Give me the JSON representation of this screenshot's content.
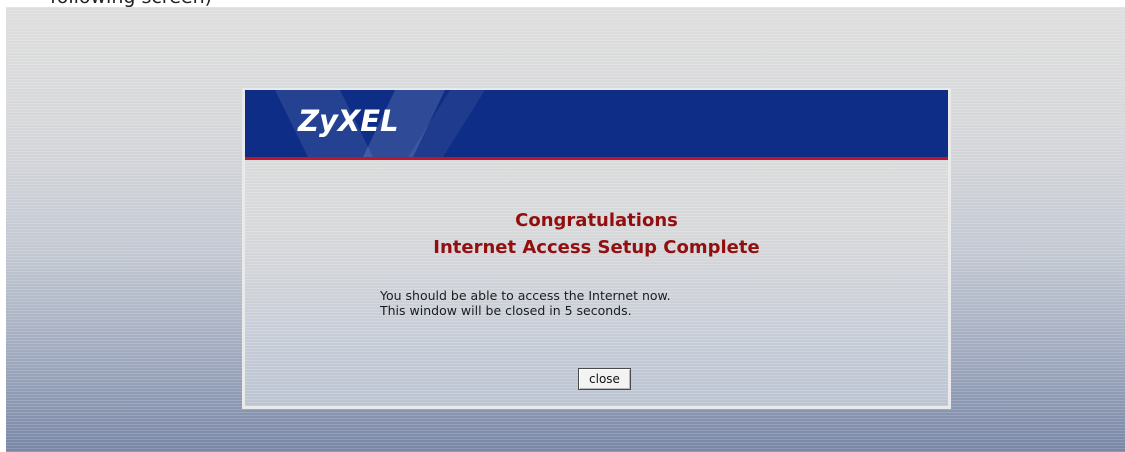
{
  "document": {
    "caption": "following screen)"
  },
  "window": {
    "brand": {
      "logo_text": "ZyXEL",
      "banner_color": "#0d2d86",
      "stripe_color": "#c0142a"
    },
    "headline": {
      "line1": "Congratulations",
      "line2": "Internet Access Setup Complete",
      "color": "#920f0f"
    },
    "message": {
      "line1": "You should be able to access the Internet now.",
      "line2": "This window will be closed in 5 seconds."
    },
    "actions": {
      "close_label": "close"
    }
  }
}
